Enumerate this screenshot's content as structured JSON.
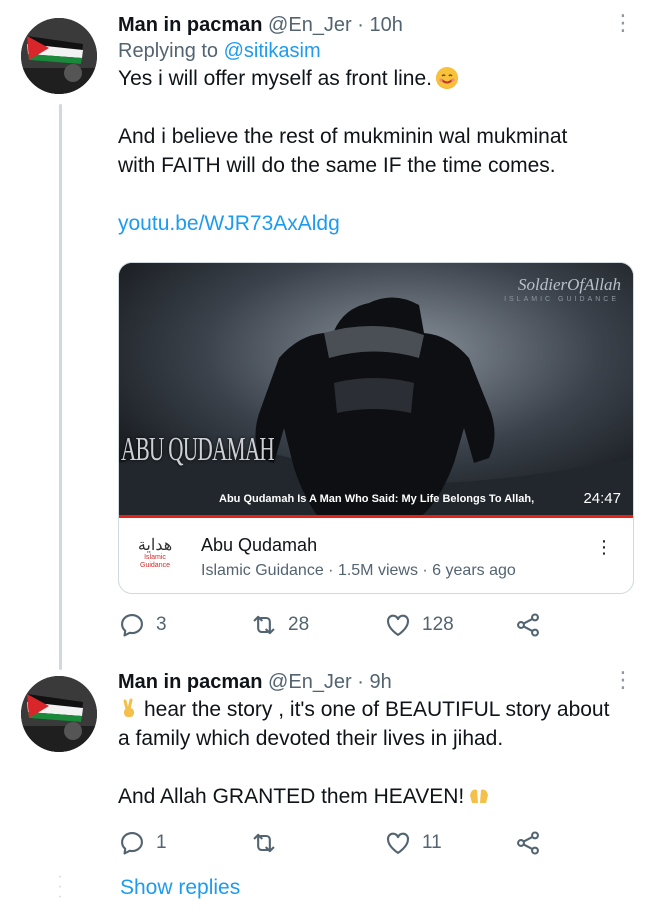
{
  "tweets": [
    {
      "name": "Man in pacman",
      "handle": "@En_Jer",
      "time": "· 10h",
      "replying_label": "Replying to",
      "replying_handle": "@sitikasim",
      "text_line1": "Yes i will offer myself as front line.",
      "text_para2_line1": "And i believe the rest of mukminin wal mukminat",
      "text_para2_line2": "with FAITH will do the same IF the time comes.",
      "link": "youtu.be/WJR73AxAldg",
      "card": {
        "video_caption": "Abu Qudamah Is A Man Who Said: My Life Belongs To Allah,",
        "duration": "24:47",
        "overlay_text": "ABU QUDAMAH",
        "watermark": "SoldierOfAllah",
        "watermark_sub": "ISLAMIC GUIDANCE",
        "title": "Abu Qudamah",
        "channel": "Islamic Guidance · 1.5M views · 6 years ago",
        "logo_arabic": "هداية",
        "logo_sub_1": "Islamic",
        "logo_sub_2": "Guidance"
      },
      "actions": {
        "replies": "3",
        "retweets": "28",
        "likes": "128"
      }
    },
    {
      "name": "Man in pacman",
      "handle": "@En_Jer",
      "time": "· 9h",
      "text_line1": "hear the story , it's one of BEAUTIFUL story about",
      "text_line2": "a family which devoted their lives in jihad.",
      "text_line3": "And Allah GRANTED them HEAVEN!",
      "actions": {
        "replies": "1",
        "retweets": "",
        "likes": "11"
      }
    }
  ],
  "show_replies": "Show replies",
  "colors": {
    "link": "#1d9bf0",
    "secondary": "#536471",
    "progress": "#e62117"
  },
  "icons": [
    "more-icon",
    "reply-icon",
    "retweet-icon",
    "like-icon",
    "share-icon",
    "smiling-face-icon",
    "victory-hand-icon",
    "raising-hands-icon"
  ]
}
